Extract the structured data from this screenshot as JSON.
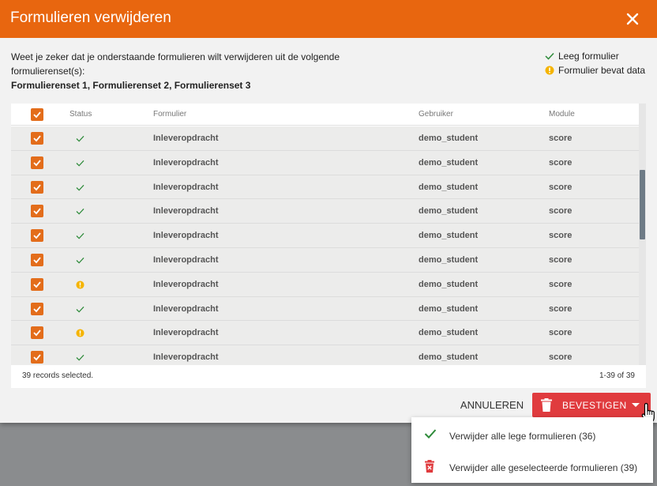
{
  "dialog": {
    "title": "Formulieren verwijderen",
    "message": "Weet je zeker dat je onderstaande formulieren wilt verwijderen uit de volgende formulierenset(s):",
    "sets": "Formulierenset 1, Formulierenset 2, Formulierenset 3"
  },
  "legend": {
    "empty": "Leeg formulier",
    "has_data": "Formulier bevat data"
  },
  "grid": {
    "columns": {
      "status": "Status",
      "form": "Formulier",
      "user": "Gebruiker",
      "module": "Module"
    },
    "rows": [
      {
        "status": "empty",
        "form": "Inleveropdracht",
        "user": "demo_student",
        "module": "score"
      },
      {
        "status": "empty",
        "form": "Inleveropdracht",
        "user": "demo_student",
        "module": "score"
      },
      {
        "status": "empty",
        "form": "Inleveropdracht",
        "user": "demo_student",
        "module": "score"
      },
      {
        "status": "empty",
        "form": "Inleveropdracht",
        "user": "demo_student",
        "module": "score"
      },
      {
        "status": "empty",
        "form": "Inleveropdracht",
        "user": "demo_student",
        "module": "score"
      },
      {
        "status": "empty",
        "form": "Inleveropdracht",
        "user": "demo_student",
        "module": "score"
      },
      {
        "status": "data",
        "form": "Inleveropdracht",
        "user": "demo_student",
        "module": "score"
      },
      {
        "status": "empty",
        "form": "Inleveropdracht",
        "user": "demo_student",
        "module": "score"
      },
      {
        "status": "data",
        "form": "Inleveropdracht",
        "user": "demo_student",
        "module": "score"
      },
      {
        "status": "empty",
        "form": "Inleveropdracht",
        "user": "demo_student",
        "module": "score"
      }
    ],
    "selected_text": "39 records selected.",
    "pagination": "1-39 of 39"
  },
  "actions": {
    "cancel": "ANNULEREN",
    "confirm": "BEVESTIGEN"
  },
  "menu": {
    "items": [
      {
        "label": "Verwijder alle lege formulieren (36)",
        "icon": "check-icon"
      },
      {
        "label": "Verwijder alle geselecteerde formulieren (39)",
        "icon": "delete-icon"
      }
    ]
  },
  "colors": {
    "header": "#e8660f",
    "checkbox": "#e36d1b",
    "confirm": "#e03b3e",
    "check_green": "#2e8b3a",
    "warning": "#f5b400"
  }
}
